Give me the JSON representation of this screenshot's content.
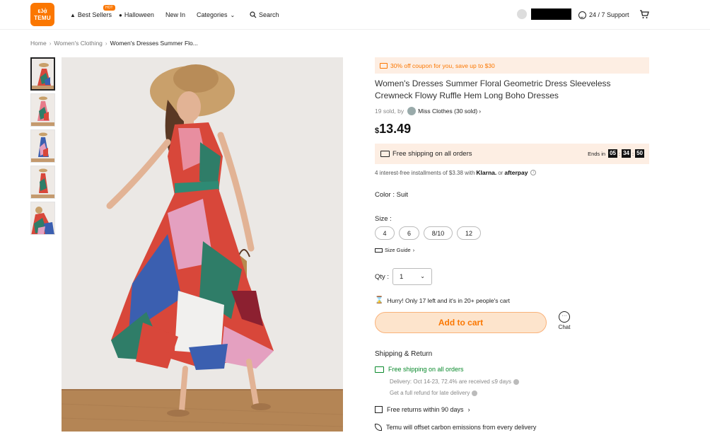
{
  "header": {
    "logo_line1": "ᴇʖᾀ",
    "logo_line2": "TEMU",
    "nav": {
      "best_sellers": "Best Sellers",
      "hot_badge": "HOT",
      "halloween": "Halloween",
      "new_in": "New In",
      "categories": "Categories",
      "search": "Search"
    },
    "support": "24 / 7 Support"
  },
  "breadcrumb": [
    "Home",
    "Women's Clothing",
    "Women's Dresses Summer Flo..."
  ],
  "product": {
    "coupon": "30% off coupon for you, save up to $30",
    "title": "Women's Dresses Summer Floral Geometric Dress Sleeveless Crewneck Flowy Ruffle Hem Long Boho Dresses",
    "sold_prefix": "19 sold, by",
    "store": "Miss Clothes (30 sold)",
    "currency": "$",
    "price": "13.49",
    "shipping_banner": "Free shipping on all orders",
    "ends_in_label": "Ends in",
    "timer": [
      "05",
      "34",
      "50"
    ],
    "installments_text": "4 interest-free installments of $3.38 with",
    "klarna": "Klarna.",
    "or_text": "or",
    "afterpay": "afterpay",
    "color_label": "Color : Suit",
    "size_label": "Size :",
    "sizes": [
      "4",
      "6",
      "8/10",
      "12"
    ],
    "size_guide": "Size Guide",
    "qty_label": "Qty :",
    "qty_value": "1",
    "hurry": "Hurry! Only 17 left and it's in 20+ people's cart",
    "add_to_cart": "Add to cart",
    "chat": "Chat"
  },
  "shipping_return": {
    "title": "Shipping & Return",
    "free_shipping": "Free shipping on all orders",
    "delivery": "Delivery: Oct 14-23, 72.4% are received ≤9 days",
    "refund": "Get a full refund for late delivery",
    "free_returns": "Free returns within 90 days",
    "carbon": "Temu will offset carbon emissions from every delivery"
  },
  "colors": {
    "accent": "#fb7701",
    "banner_bg": "#fdeee3",
    "green": "#0a8a2c"
  }
}
